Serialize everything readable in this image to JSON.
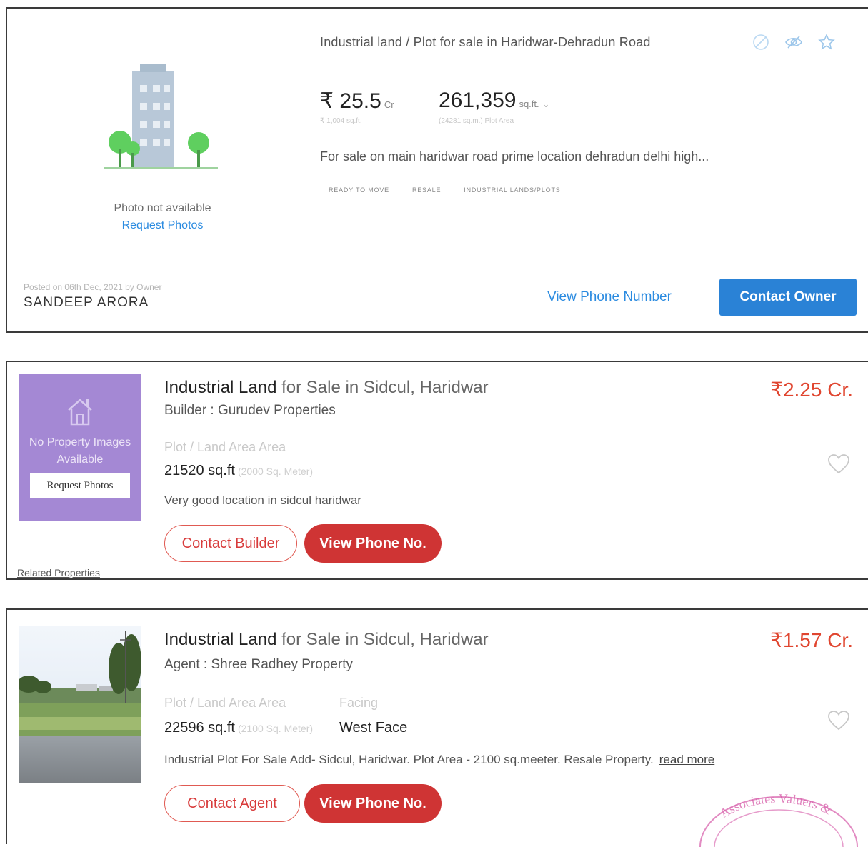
{
  "listing1": {
    "photo_unavailable": "Photo not available",
    "request_photos": "Request Photos",
    "title": "Industrial land / Plot for sale in Haridwar-Dehradun Road",
    "price": "₹ 25.5",
    "price_unit": "Cr",
    "price_per_sqft": "₹ 1,004 sq.ft.",
    "area": "261,359",
    "area_unit": "sq.ft.",
    "area_sub": "(24281 sq.m.) Plot Area",
    "description": "For sale on main haridwar road prime location dehradun delhi high...",
    "tags": [
      "READY TO MOVE",
      "RESALE",
      "INDUSTRIAL LANDS/PLOTS"
    ],
    "posted": "Posted on 06th Dec, 2021 by Owner",
    "owner": "SANDEEP ARORA",
    "view_phone": "View Phone Number",
    "contact_owner": "Contact Owner",
    "colors": {
      "primary": "#2a82d6",
      "link": "#2b8be0"
    }
  },
  "listing2": {
    "no_images": "No Property Images Available",
    "request_photos": "Request Photos",
    "title_strong": "Industrial Land",
    "title_rest": "for Sale in Sidcul, Haridwar",
    "by_line": "Builder : Gurudev Properties",
    "area_label": "Plot / Land Area Area",
    "area_value": "21520 sq.ft",
    "area_sub": "(2000 Sq. Meter)",
    "description": "Very good location in sidcul haridwar",
    "price": "₹2.25 Cr.",
    "contact_button": "Contact Builder",
    "phone_button": "View Phone No.",
    "related": "Related Properties",
    "colors": {
      "accent": "#cf3434",
      "price": "#e0452f",
      "placeholder_bg": "#a488d4"
    }
  },
  "listing3": {
    "title_strong": "Industrial Land",
    "title_rest": "for Sale in Sidcul, Haridwar",
    "by_line": "Agent : Shree Radhey Property",
    "area_label": "Plot / Land Area Area",
    "area_value": "22596 sq.ft",
    "area_sub": "(2100 Sq. Meter)",
    "facing_label": "Facing",
    "facing_value": "West Face",
    "description": "Industrial Plot For Sale Add- Sidcul, Haridwar. Plot Area - 2100 sq.meeter. Resale Property.",
    "read_more": "read more",
    "price": "₹1.57 Cr.",
    "contact_button": "Contact Agent",
    "phone_button": "View Phone No.",
    "stamp_text": "Associates Valuers &"
  }
}
